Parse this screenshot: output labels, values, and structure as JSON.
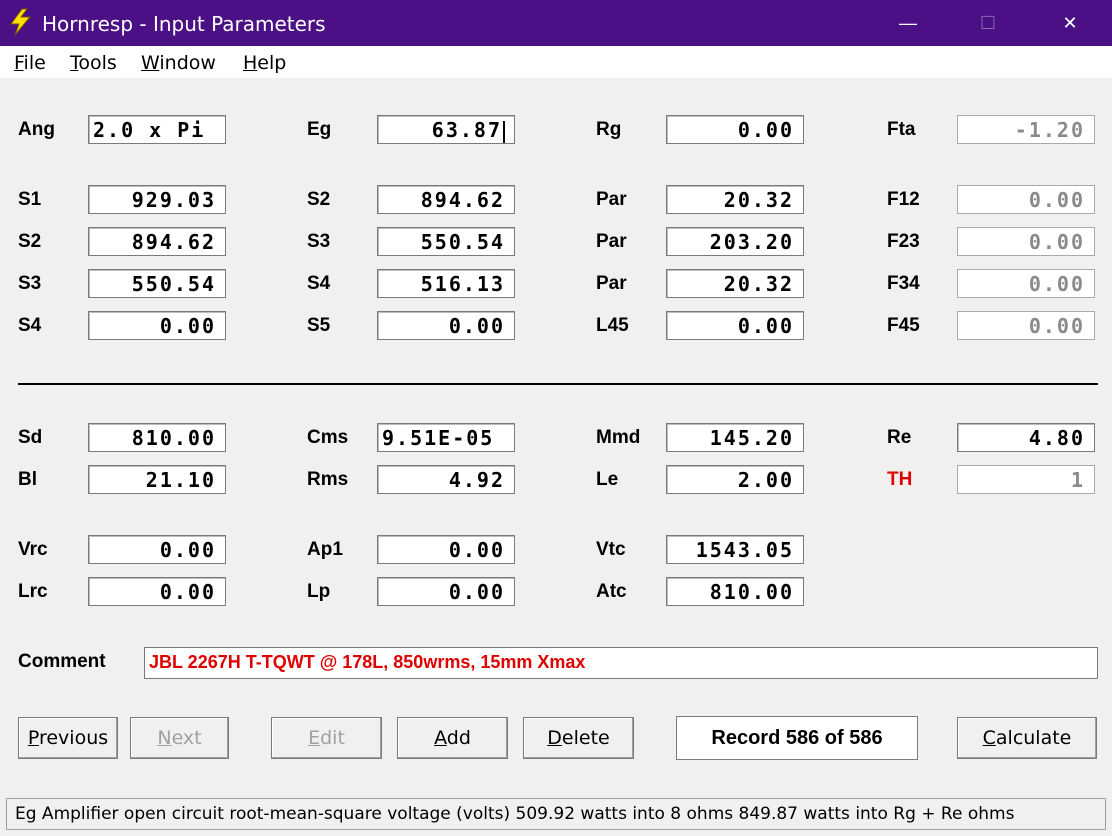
{
  "window": {
    "title": "Hornresp - Input Parameters",
    "minimize_glyph": "—",
    "maximize_glyph": "☐",
    "close_glyph": "✕",
    "icon": "lightning-icon",
    "accent": "#4b0f86"
  },
  "menu": [
    {
      "label": "File"
    },
    {
      "label": "Tools"
    },
    {
      "label": "Window"
    },
    {
      "label": "Help"
    }
  ],
  "top": {
    "ang": {
      "label": "Ang",
      "value": "2.0 x Pi"
    },
    "eg": {
      "label": "Eg",
      "value": "63.87"
    },
    "rg": {
      "label": "Rg",
      "value": "0.00"
    },
    "fta": {
      "label": "Fta",
      "value": "-1.20"
    }
  },
  "rows": [
    {
      "c1": {
        "label": "S1",
        "value": "929.03"
      },
      "c2": {
        "label": "S2",
        "value": "894.62"
      },
      "c3": {
        "label": "Par",
        "value": "20.32"
      },
      "c4": {
        "label": "F12",
        "value": "0.00"
      }
    },
    {
      "c1": {
        "label": "S2",
        "value": "894.62"
      },
      "c2": {
        "label": "S3",
        "value": "550.54"
      },
      "c3": {
        "label": "Par",
        "value": "203.20"
      },
      "c4": {
        "label": "F23",
        "value": "0.00"
      }
    },
    {
      "c1": {
        "label": "S3",
        "value": "550.54"
      },
      "c2": {
        "label": "S4",
        "value": "516.13"
      },
      "c3": {
        "label": "Par",
        "value": "20.32"
      },
      "c4": {
        "label": "F34",
        "value": "0.00"
      }
    },
    {
      "c1": {
        "label": "S4",
        "value": "0.00"
      },
      "c2": {
        "label": "S5",
        "value": "0.00"
      },
      "c3": {
        "label": "L45",
        "value": "0.00"
      },
      "c4": {
        "label": "F45",
        "value": "0.00"
      }
    }
  ],
  "driver": {
    "sd": {
      "label": "Sd",
      "value": "810.00"
    },
    "cms": {
      "label": "Cms",
      "value": "9.51E-05"
    },
    "mmd": {
      "label": "Mmd",
      "value": "145.20"
    },
    "re": {
      "label": "Re",
      "value": "4.80"
    },
    "bl": {
      "label": "Bl",
      "value": "21.10"
    },
    "rms": {
      "label": "Rms",
      "value": "4.92"
    },
    "le": {
      "label": "Le",
      "value": "2.00"
    },
    "th": {
      "label": "TH",
      "value": "1"
    }
  },
  "chamber": {
    "vrc": {
      "label": "Vrc",
      "value": "0.00"
    },
    "ap1": {
      "label": "Ap1",
      "value": "0.00"
    },
    "vtc": {
      "label": "Vtc",
      "value": "1543.05"
    },
    "lrc": {
      "label": "Lrc",
      "value": "0.00"
    },
    "lp": {
      "label": "Lp",
      "value": "0.00"
    },
    "atc": {
      "label": "Atc",
      "value": "810.00"
    }
  },
  "comment": {
    "label": "Comment",
    "value": "JBL 2267H T-TQWT @ 178L, 850wrms, 15mm Xmax",
    "color": "#e00000"
  },
  "buttons": {
    "previous": "Previous",
    "next": "Next",
    "edit": "Edit",
    "add": "Add",
    "delete": "Delete",
    "calculate": "Calculate"
  },
  "record": "Record 586 of 586",
  "status": "Eg  Amplifier open circuit root-mean-square voltage  (volts)  509.92 watts into 8 ohms   849.87 watts into Rg + Re ohms"
}
